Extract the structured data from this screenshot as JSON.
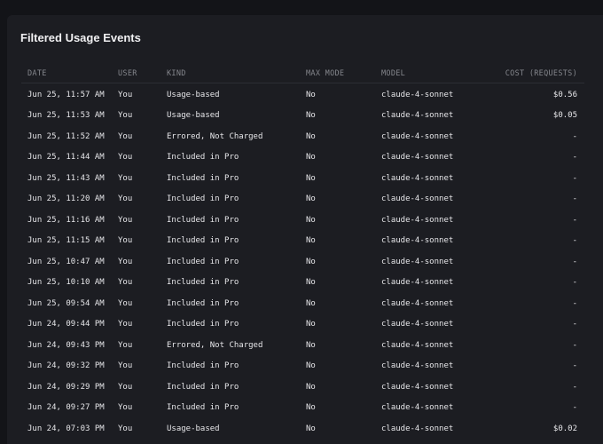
{
  "panel": {
    "title": "Filtered Usage Events"
  },
  "table": {
    "headers": {
      "date": "DATE",
      "user": "USER",
      "kind": "KIND",
      "max_mode": "MAX MODE",
      "model": "MODEL",
      "cost": "COST (REQUESTS)"
    },
    "rows": [
      {
        "date": "Jun 25, 11:57 AM",
        "user": "You",
        "kind": "Usage-based",
        "max_mode": "No",
        "model": "claude-4-sonnet",
        "cost": "$0.56"
      },
      {
        "date": "Jun 25, 11:53 AM",
        "user": "You",
        "kind": "Usage-based",
        "max_mode": "No",
        "model": "claude-4-sonnet",
        "cost": "$0.05"
      },
      {
        "date": "Jun 25, 11:52 AM",
        "user": "You",
        "kind": "Errored, Not Charged",
        "max_mode": "No",
        "model": "claude-4-sonnet",
        "cost": "-"
      },
      {
        "date": "Jun 25, 11:44 AM",
        "user": "You",
        "kind": "Included in Pro",
        "max_mode": "No",
        "model": "claude-4-sonnet",
        "cost": "-"
      },
      {
        "date": "Jun 25, 11:43 AM",
        "user": "You",
        "kind": "Included in Pro",
        "max_mode": "No",
        "model": "claude-4-sonnet",
        "cost": "-"
      },
      {
        "date": "Jun 25, 11:20 AM",
        "user": "You",
        "kind": "Included in Pro",
        "max_mode": "No",
        "model": "claude-4-sonnet",
        "cost": "-"
      },
      {
        "date": "Jun 25, 11:16 AM",
        "user": "You",
        "kind": "Included in Pro",
        "max_mode": "No",
        "model": "claude-4-sonnet",
        "cost": "-"
      },
      {
        "date": "Jun 25, 11:15 AM",
        "user": "You",
        "kind": "Included in Pro",
        "max_mode": "No",
        "model": "claude-4-sonnet",
        "cost": "-"
      },
      {
        "date": "Jun 25, 10:47 AM",
        "user": "You",
        "kind": "Included in Pro",
        "max_mode": "No",
        "model": "claude-4-sonnet",
        "cost": "-"
      },
      {
        "date": "Jun 25, 10:10 AM",
        "user": "You",
        "kind": "Included in Pro",
        "max_mode": "No",
        "model": "claude-4-sonnet",
        "cost": "-"
      },
      {
        "date": "Jun 25, 09:54 AM",
        "user": "You",
        "kind": "Included in Pro",
        "max_mode": "No",
        "model": "claude-4-sonnet",
        "cost": "-"
      },
      {
        "date": "Jun 24, 09:44 PM",
        "user": "You",
        "kind": "Included in Pro",
        "max_mode": "No",
        "model": "claude-4-sonnet",
        "cost": "-"
      },
      {
        "date": "Jun 24, 09:43 PM",
        "user": "You",
        "kind": "Errored, Not Charged",
        "max_mode": "No",
        "model": "claude-4-sonnet",
        "cost": "-"
      },
      {
        "date": "Jun 24, 09:32 PM",
        "user": "You",
        "kind": "Included in Pro",
        "max_mode": "No",
        "model": "claude-4-sonnet",
        "cost": "-"
      },
      {
        "date": "Jun 24, 09:29 PM",
        "user": "You",
        "kind": "Included in Pro",
        "max_mode": "No",
        "model": "claude-4-sonnet",
        "cost": "-"
      },
      {
        "date": "Jun 24, 09:27 PM",
        "user": "You",
        "kind": "Included in Pro",
        "max_mode": "No",
        "model": "claude-4-sonnet",
        "cost": "-"
      },
      {
        "date": "Jun 24, 07:03 PM",
        "user": "You",
        "kind": "Usage-based",
        "max_mode": "No",
        "model": "claude-4-sonnet",
        "cost": "$0.02"
      }
    ]
  }
}
